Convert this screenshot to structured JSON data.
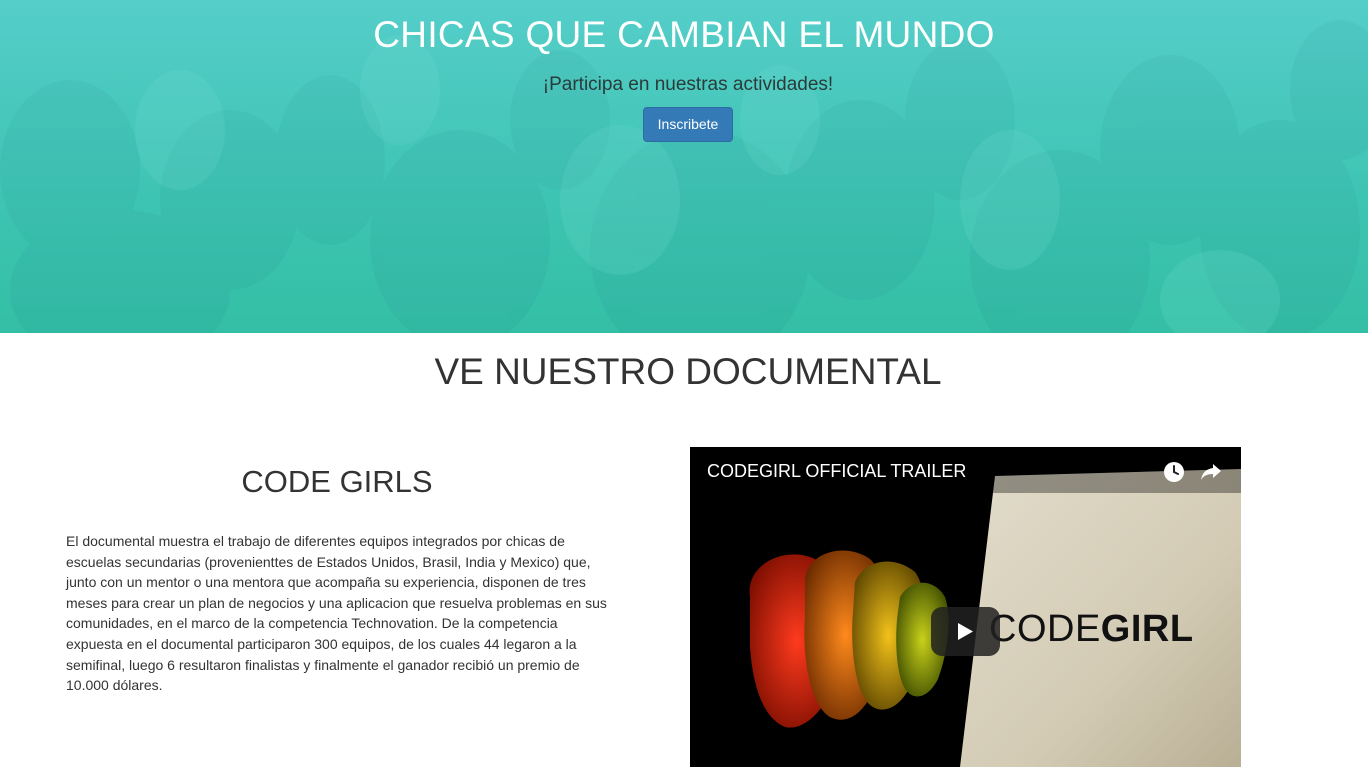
{
  "hero": {
    "title": "CHICAS QUE CAMBIAN EL MUNDO",
    "subtitle": "¡Participa en nuestras actividades!",
    "button_label": "Inscribete",
    "background_color": "#3dc3b3",
    "button_color": "#337ab7"
  },
  "documentary": {
    "heading": "VE NUESTRO DOCUMENTAL",
    "article": {
      "title": "CODE GIRLS",
      "body": "El documental muestra el trabajo de diferentes equipos integrados por chicas de escuelas secundarias (provenienttes de Estados Unidos, Brasil, India y Mexico) que, junto con un mentor o una mentora que acompaña su experiencia, disponen de tres meses para crear un plan de negocios y una aplicacion que resuelva problemas en sus comunidades, en el marco de la competencia Technovation. De la competencia expuesta en el documental participaron 300 equipos, de los cuales 44 legaron a la semifinal, luego 6 resultaron finalistas y finalmente el ganador recibió un premio de 10.000 dólares."
    },
    "video": {
      "title": "CODEGIRL OFFICIAL TRAILER",
      "logo_light": "CODE",
      "logo_bold": "GIRL",
      "icons": [
        "clock-icon",
        "share-icon",
        "play-icon"
      ]
    }
  }
}
